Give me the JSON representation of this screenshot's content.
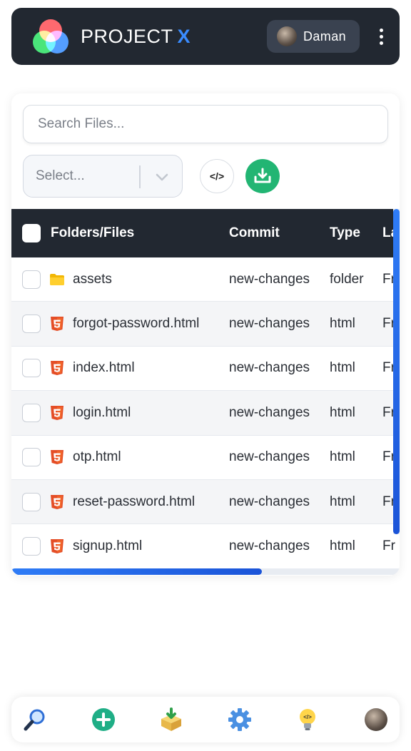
{
  "header": {
    "brand_text": "PROJECT",
    "brand_x": "X",
    "user_name": "Daman",
    "colors": {
      "background": "#222831",
      "accent": "#3a8cff"
    }
  },
  "toolbar": {
    "search_placeholder": "Search Files...",
    "select_placeholder": "Select...",
    "code_button_label": "</>",
    "download_icon": "download-icon"
  },
  "table": {
    "headers": [
      "Folders/Files",
      "Commit",
      "Type",
      "La"
    ],
    "rows": [
      {
        "name": "assets",
        "commit": "new-changes",
        "type": "folder",
        "last": "Fr",
        "icon": "folder-icon"
      },
      {
        "name": "forgot-password.html",
        "commit": "new-changes",
        "type": "html",
        "last": "Fr",
        "icon": "html5-icon"
      },
      {
        "name": "index.html",
        "commit": "new-changes",
        "type": "html",
        "last": "Fr",
        "icon": "html5-icon"
      },
      {
        "name": "login.html",
        "commit": "new-changes",
        "type": "html",
        "last": "Fr",
        "icon": "html5-icon"
      },
      {
        "name": "otp.html",
        "commit": "new-changes",
        "type": "html",
        "last": "Fr",
        "icon": "html5-icon"
      },
      {
        "name": "reset-password.html",
        "commit": "new-changes",
        "type": "html",
        "last": "Fr",
        "icon": "html5-icon"
      },
      {
        "name": "signup.html",
        "commit": "new-changes",
        "type": "html",
        "last": "Fr",
        "icon": "html5-icon"
      }
    ]
  },
  "bottom_nav": {
    "items": [
      "search-icon",
      "add-icon",
      "download-box-icon",
      "settings-gear-icon",
      "idea-bulb-icon",
      "profile-avatar"
    ]
  }
}
